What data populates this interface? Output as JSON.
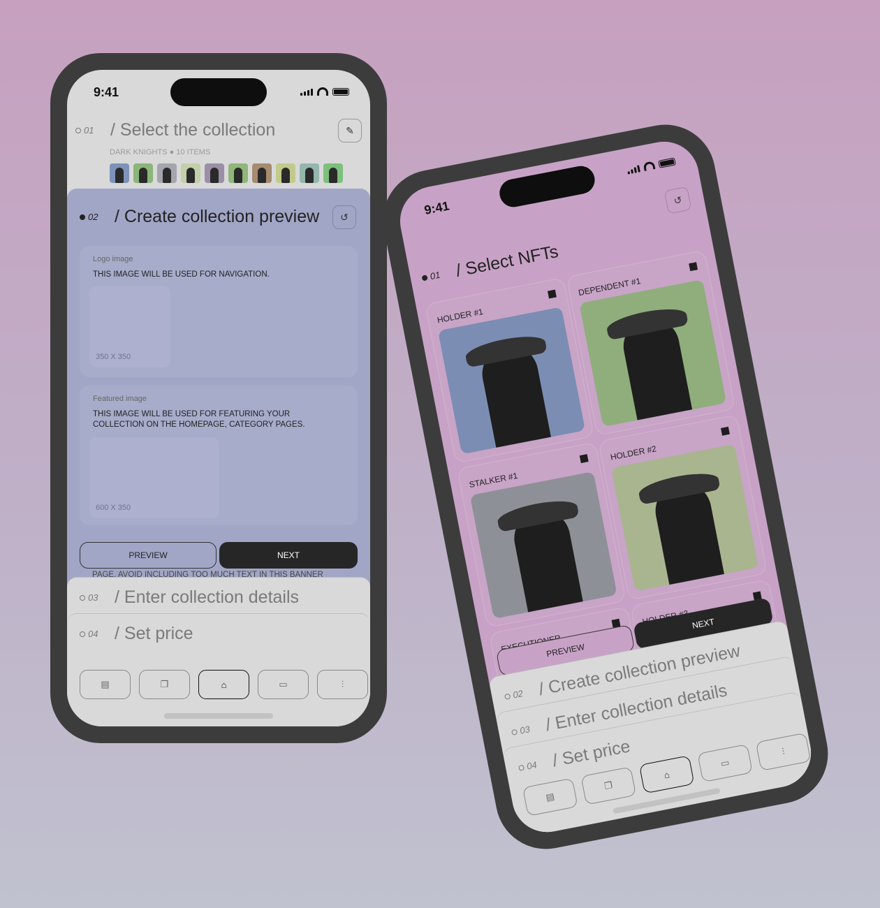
{
  "status_time": "9:41",
  "left_phone": {
    "step1": {
      "num": "01",
      "title": "/ Select the collection",
      "collection": "DARK KNIGHTS",
      "items": "10 ITEMS",
      "edit_icon": "pencil-icon",
      "thumb_colors": [
        "#7e93b8",
        "#8cb57a",
        "#a5a5ad",
        "#c3cfa8",
        "#9b8fa8",
        "#8fb77a",
        "#a58b6f",
        "#c2c98a",
        "#94b6ad",
        "#7cc07c"
      ]
    },
    "step2": {
      "num": "02",
      "title": "/ Create collection preview",
      "reset_icon": "undo-icon",
      "logo": {
        "label": "Logo image",
        "desc": "THIS IMAGE WILL BE USED FOR NAVIGATION.",
        "size": "350 X 350"
      },
      "featured": {
        "label": "Featured image",
        "desc": "THIS IMAGE WILL BE USED FOR FEATURING YOUR COLLECTION ON THE HOMEPAGE, CATEGORY PAGES.",
        "size": "600 X 350"
      },
      "overflow_text": "PAGE. AVOID INCLUDING TOO MUCH TEXT IN THIS BANNER"
    },
    "preview_label": "PREVIEW",
    "next_label": "NEXT",
    "step3": {
      "num": "03",
      "title": "/ Enter collection details"
    },
    "step4": {
      "num": "04",
      "title": "/ Set price"
    }
  },
  "right_phone": {
    "step1": {
      "num": "01",
      "title": "/ Select NFTs"
    },
    "nfts": [
      {
        "name": "HOLDER #1",
        "bg": "#7b8db3",
        "selected": true
      },
      {
        "name": "DEPENDENT #1",
        "bg": "#8fae7c",
        "selected": true
      },
      {
        "name": "STALKER #1",
        "bg": "#8e9098",
        "selected": true
      },
      {
        "name": "HOLDER #2",
        "bg": "#a9b58f",
        "selected": true
      },
      {
        "name": "EXECUTIONER",
        "bg": "#9a9aa0",
        "selected": true
      },
      {
        "name": "HOLDER #3",
        "bg": "#a8b88a",
        "selected": true
      }
    ],
    "preview_label": "PREVIEW",
    "next_label": "NEXT",
    "step2": {
      "num": "02",
      "title": "/ Create collection preview"
    },
    "step3": {
      "num": "03",
      "title": "/ Enter collection details"
    },
    "step4": {
      "num": "04",
      "title": "/ Set price"
    }
  },
  "tabs": [
    {
      "icon": "cards-icon",
      "glyph": "▤",
      "active": false
    },
    {
      "icon": "copy-icon",
      "glyph": "❐",
      "active": false
    },
    {
      "icon": "store-icon",
      "glyph": "⌂",
      "active": true
    },
    {
      "icon": "wallet-icon",
      "glyph": "▭",
      "active": false
    },
    {
      "icon": "sliders-icon",
      "glyph": "⫶",
      "active": false
    }
  ]
}
